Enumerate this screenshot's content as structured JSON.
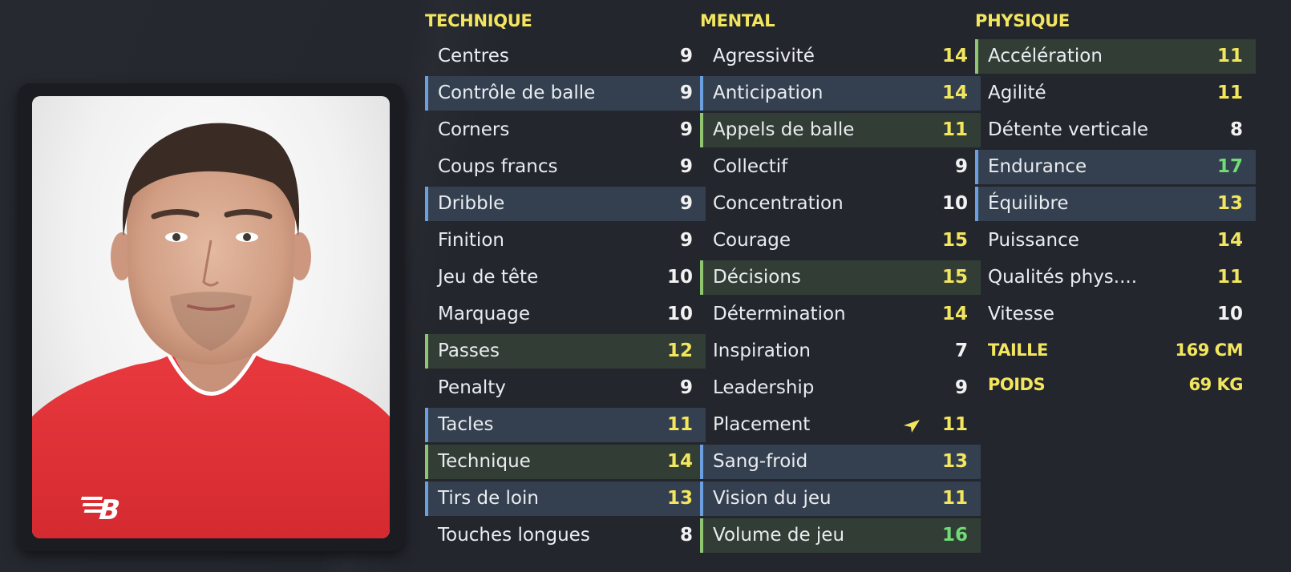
{
  "columns": [
    {
      "title": "TECHNIQUE",
      "rows": [
        {
          "name": "Centres",
          "value": "9",
          "hl": "",
          "color": "white"
        },
        {
          "name": "Contrôle de balle",
          "value": "9",
          "hl": "blue",
          "color": "white"
        },
        {
          "name": "Corners",
          "value": "9",
          "hl": "",
          "color": "white"
        },
        {
          "name": "Coups francs",
          "value": "9",
          "hl": "",
          "color": "white"
        },
        {
          "name": "Dribble",
          "value": "9",
          "hl": "blue",
          "color": "white"
        },
        {
          "name": "Finition",
          "value": "9",
          "hl": "",
          "color": "white"
        },
        {
          "name": "Jeu de tête",
          "value": "10",
          "hl": "",
          "color": "white"
        },
        {
          "name": "Marquage",
          "value": "10",
          "hl": "",
          "color": "white"
        },
        {
          "name": "Passes",
          "value": "12",
          "hl": "green",
          "color": "yellow"
        },
        {
          "name": "Penalty",
          "value": "9",
          "hl": "",
          "color": "white"
        },
        {
          "name": "Tacles",
          "value": "11",
          "hl": "blue",
          "color": "yellow"
        },
        {
          "name": "Technique",
          "value": "14",
          "hl": "green",
          "color": "yellow"
        },
        {
          "name": "Tirs de loin",
          "value": "13",
          "hl": "blue",
          "color": "yellow"
        },
        {
          "name": "Touches longues",
          "value": "8",
          "hl": "",
          "color": "white"
        }
      ]
    },
    {
      "title": "MENTAL",
      "rows": [
        {
          "name": "Agressivité",
          "value": "14",
          "hl": "",
          "color": "yellow"
        },
        {
          "name": "Anticipation",
          "value": "14",
          "hl": "blue",
          "color": "yellow"
        },
        {
          "name": "Appels de balle",
          "value": "11",
          "hl": "green",
          "color": "yellow"
        },
        {
          "name": "Collectif",
          "value": "9",
          "hl": "",
          "color": "white"
        },
        {
          "name": "Concentration",
          "value": "10",
          "hl": "",
          "color": "white"
        },
        {
          "name": "Courage",
          "value": "15",
          "hl": "",
          "color": "yellow"
        },
        {
          "name": "Décisions",
          "value": "15",
          "hl": "green",
          "color": "yellow"
        },
        {
          "name": "Détermination",
          "value": "14",
          "hl": "",
          "color": "yellow"
        },
        {
          "name": "Inspiration",
          "value": "7",
          "hl": "",
          "color": "white"
        },
        {
          "name": "Leadership",
          "value": "9",
          "hl": "",
          "color": "white"
        },
        {
          "name": "Placement",
          "value": "11",
          "hl": "",
          "color": "yellow"
        },
        {
          "name": "Sang-froid",
          "value": "13",
          "hl": "blue",
          "color": "yellow"
        },
        {
          "name": "Vision du jeu",
          "value": "11",
          "hl": "blue",
          "color": "yellow"
        },
        {
          "name": "Volume de jeu",
          "value": "16",
          "hl": "green",
          "color": "green"
        }
      ]
    },
    {
      "title": "PHYSIQUE",
      "rows": [
        {
          "name": "Accélération",
          "value": "11",
          "hl": "green",
          "color": "yellow"
        },
        {
          "name": "Agilité",
          "value": "11",
          "hl": "",
          "color": "yellow"
        },
        {
          "name": "Détente verticale",
          "value": "8",
          "hl": "",
          "color": "white"
        },
        {
          "name": "Endurance",
          "value": "17",
          "hl": "blue",
          "color": "green"
        },
        {
          "name": "Équilibre",
          "value": "13",
          "hl": "blue",
          "color": "yellow"
        },
        {
          "name": "Puissance",
          "value": "14",
          "hl": "",
          "color": "yellow"
        },
        {
          "name": "Qualités phys....",
          "value": "11",
          "hl": "",
          "color": "yellow"
        },
        {
          "name": "Vitesse",
          "value": "10",
          "hl": "",
          "color": "white"
        }
      ]
    }
  ],
  "physical_info": {
    "height_label": "TAILLE",
    "height_value": "169 CM",
    "weight_label": "POIDS",
    "weight_value": "69 KG"
  },
  "colors": {
    "accent_yellow": "#f3e65e",
    "value_green": "#6fdc76",
    "highlight_blue": "#6b9fe0",
    "highlight_green": "#8fc470"
  }
}
